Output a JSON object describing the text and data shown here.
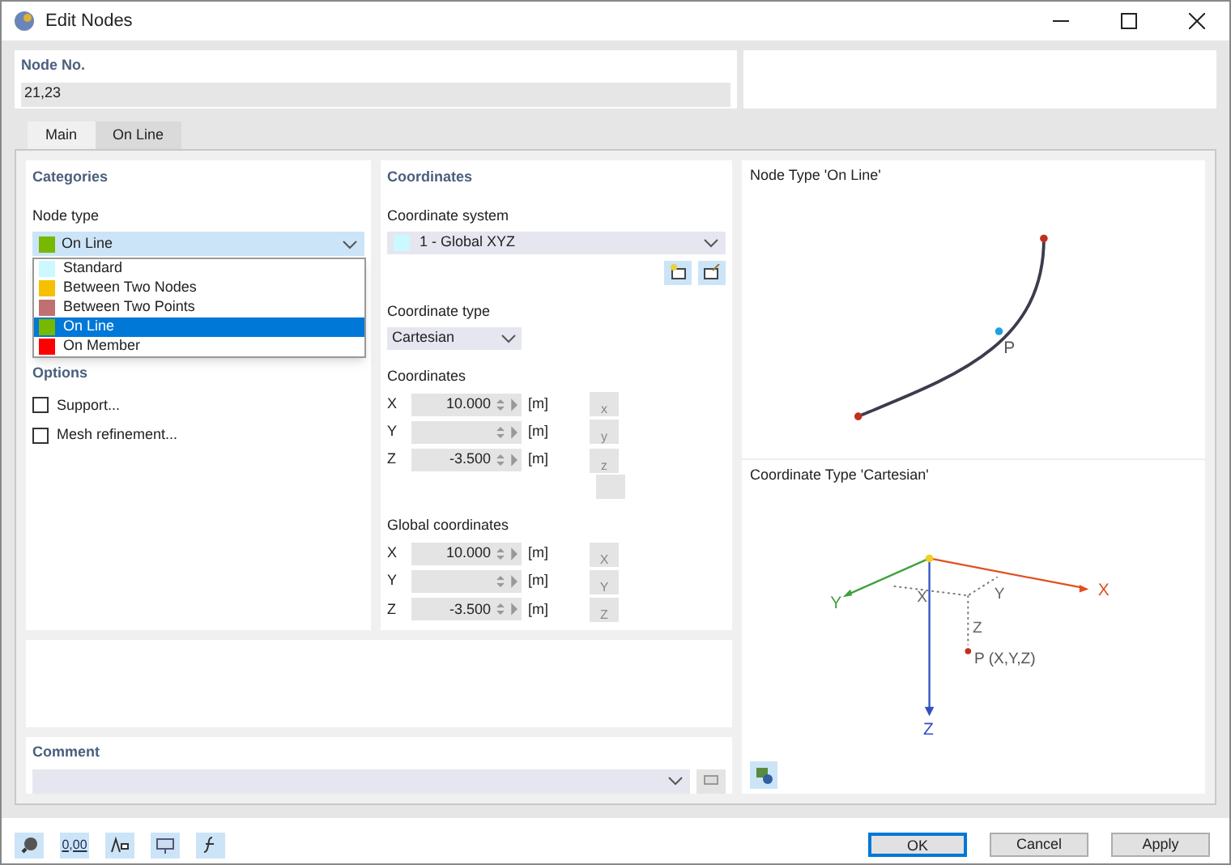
{
  "window": {
    "title": "Edit Nodes"
  },
  "node_no": {
    "label": "Node No.",
    "value": "21,23"
  },
  "tabs": [
    {
      "label": "Main",
      "selected": true
    },
    {
      "label": "On Line",
      "selected": false
    }
  ],
  "categories": {
    "title": "Categories",
    "node_type_label": "Node type",
    "node_type": {
      "value": "On Line",
      "color": "#77b800"
    },
    "options_list": [
      {
        "label": "Standard",
        "color": "#ccf8ff",
        "selected": false
      },
      {
        "label": "Between Two Nodes",
        "color": "#f5c000",
        "selected": false
      },
      {
        "label": "Between Two Points",
        "color": "#c07070",
        "selected": false
      },
      {
        "label": "On Line",
        "color": "#77b800",
        "selected": true
      },
      {
        "label": "On Member",
        "color": "#ff0000",
        "selected": false
      }
    ],
    "options_title": "Options",
    "options": [
      {
        "label": "Support...",
        "checked": false
      },
      {
        "label": "Mesh refinement...",
        "checked": false
      }
    ]
  },
  "coordinates": {
    "title": "Coordinates",
    "system_label": "Coordinate system",
    "system": {
      "value": "1 - Global XYZ",
      "color": "#ccf8ff"
    },
    "type_label": "Coordinate type",
    "type": "Cartesian",
    "coords_label": "Coordinates",
    "coords": [
      {
        "axis": "X",
        "value": "10.000",
        "unit": "[m]",
        "pick": "x"
      },
      {
        "axis": "Y",
        "unit": "[m]",
        "pick": "y"
      },
      {
        "axis": "Z",
        "value": "-3.500",
        "unit": "[m]",
        "pick": "z"
      }
    ],
    "global_label": "Global coordinates",
    "global": [
      {
        "axis": "X",
        "value": "10.000",
        "unit": "[m]",
        "pick": "X"
      },
      {
        "axis": "Y",
        "unit": "[m]",
        "pick": "Y"
      },
      {
        "axis": "Z",
        "value": "-3.500",
        "unit": "[m]",
        "pick": "Z"
      }
    ]
  },
  "preview": {
    "node_title": "Node Type 'On Line'",
    "node_label": "P",
    "coord_title": "Coordinate Type 'Cartesian'",
    "axis_labels": [
      "X",
      "Y",
      "Z"
    ],
    "component_labels": [
      "X",
      "Y",
      "Z"
    ],
    "point_label": "P (X,Y,Z)"
  },
  "comment": {
    "label": "Comment"
  },
  "toolbar": {
    "number_format": "0,00"
  },
  "buttons": [
    "OK",
    "Cancel",
    "Apply"
  ]
}
